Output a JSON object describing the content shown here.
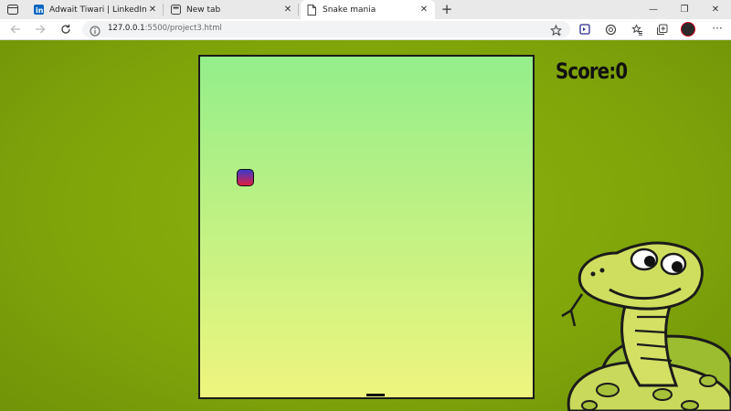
{
  "browser": {
    "tabs": [
      {
        "title": "Adwait Tiwari | LinkedIn",
        "icon": "linkedin-icon",
        "active": false
      },
      {
        "title": "New tab",
        "icon": "newtab-icon",
        "active": false
      },
      {
        "title": "Snake mania",
        "icon": "page-icon",
        "active": true
      }
    ],
    "close_glyph": "✕",
    "new_tab_glyph": "+",
    "window_controls": {
      "minimize": "—",
      "maximize": "❐",
      "close": "✕"
    },
    "url_host": "127.0.0.1",
    "url_rest": ":5500/project3.html",
    "menu_glyph": "···"
  },
  "game": {
    "score_text": "Score:0",
    "board_gradient": [
      "#93ee8a",
      "#eff57e"
    ],
    "snake_head_gradient": [
      "#3a3acd",
      "#e11d3e"
    ],
    "page_background": "#7fa40a"
  }
}
